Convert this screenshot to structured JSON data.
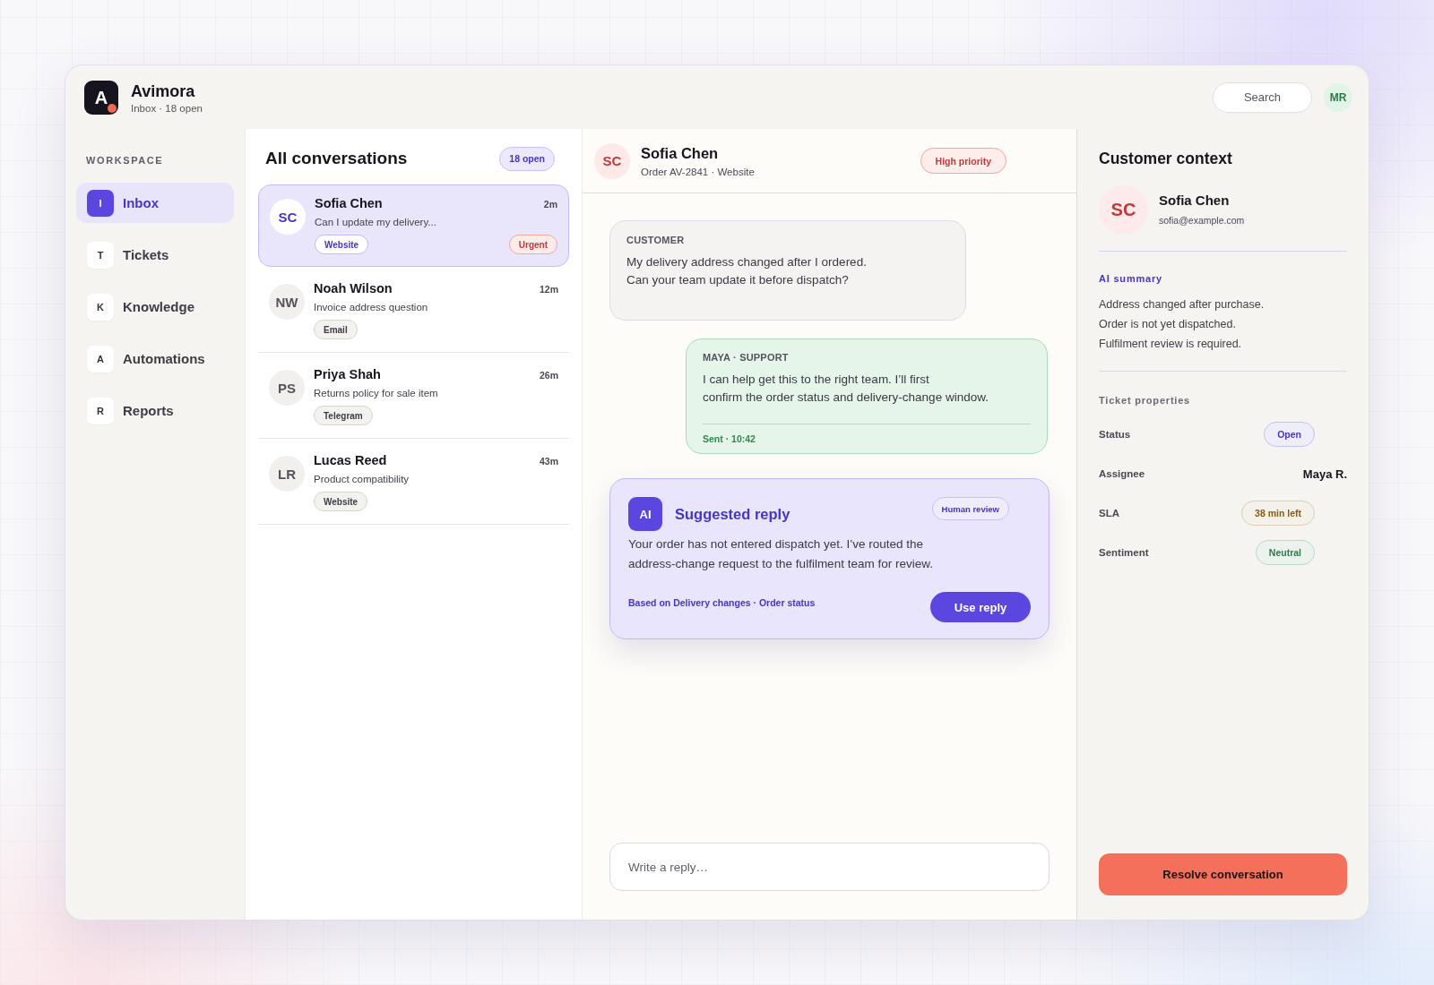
{
  "app": {
    "logo_letter": "A",
    "name": "Avimora",
    "subtitle": "Inbox · 18 open"
  },
  "search": {
    "placeholder": "Search"
  },
  "user": {
    "initials": "MR"
  },
  "sidebar": {
    "heading": "WORKSPACE",
    "items": [
      {
        "letter": "I",
        "label": "Inbox",
        "selected": true
      },
      {
        "letter": "T",
        "label": "Tickets",
        "selected": false
      },
      {
        "letter": "K",
        "label": "Knowledge",
        "selected": false
      },
      {
        "letter": "A",
        "label": "Automations",
        "selected": false
      },
      {
        "letter": "R",
        "label": "Reports",
        "selected": false
      }
    ]
  },
  "conversations": {
    "title": "All conversations",
    "badge": "18 open",
    "items": [
      {
        "initials": "SC",
        "name": "Sofia Chen",
        "time": "2m",
        "preview": "Can I update my delivery...",
        "tags": [
          {
            "label": "Website",
            "kind": "channel"
          },
          {
            "label": "Urgent",
            "kind": "priority"
          }
        ],
        "selected": true
      },
      {
        "initials": "NW",
        "name": "Noah Wilson",
        "time": "12m",
        "preview": "Invoice address question",
        "tags": [
          {
            "label": "Email",
            "kind": "channel"
          }
        ],
        "selected": false
      },
      {
        "initials": "PS",
        "name": "Priya Shah",
        "time": "26m",
        "preview": "Returns policy for sale item",
        "tags": [
          {
            "label": "Telegram",
            "kind": "channel"
          }
        ],
        "selected": false
      },
      {
        "initials": "LR",
        "name": "Lucas Reed",
        "time": "43m",
        "preview": "Product compatibility",
        "tags": [
          {
            "label": "Website",
            "kind": "channel"
          }
        ],
        "selected": false
      }
    ]
  },
  "chat": {
    "initials": "SC",
    "name": "Sofia Chen",
    "subtitle": "Order AV-2841 · Website",
    "priority": "High priority",
    "messages": [
      {
        "kind": "customer",
        "author": "CUSTOMER",
        "lines": [
          "My delivery address changed after I ordered.",
          "Can your team update it before dispatch?"
        ]
      },
      {
        "kind": "agent",
        "author": "MAYA · SUPPORT",
        "lines": [
          "I can help get this to the right team. I’ll first",
          "confirm the order status and delivery-change window."
        ],
        "footer": "Sent · 10:42"
      }
    ],
    "suggestion": {
      "badge": "AI",
      "title": "Suggested reply",
      "tag": "Human review",
      "lines": [
        "Your order has not entered dispatch yet. I’ve routed the",
        "address-change request to the fulfilment team for review."
      ],
      "source": "Based on Delivery changes · Order status",
      "action": "Use reply"
    },
    "composer": {
      "placeholder": "Write a reply…"
    }
  },
  "context": {
    "title": "Customer context",
    "initials": "SC",
    "name": "Sofia Chen",
    "email": "sofia@example.com",
    "summary_title": "AI summary",
    "summary": [
      "Address changed after purchase.",
      "Order is not yet dispatched.",
      "Fulfilment review is required."
    ],
    "properties_title": "Ticket properties",
    "properties": [
      {
        "label": "Status",
        "value": "Open",
        "kind": "pill",
        "color": "#4536c4"
      },
      {
        "label": "Assignee",
        "value": "Maya R.",
        "kind": "text"
      },
      {
        "label": "SLA",
        "value": "38 min left",
        "kind": "pill",
        "color": "#8a5a12"
      },
      {
        "label": "Sentiment",
        "value": "Neutral",
        "kind": "pill",
        "color": "#2f7a4a"
      }
    ],
    "action": "Resolve conversation"
  }
}
